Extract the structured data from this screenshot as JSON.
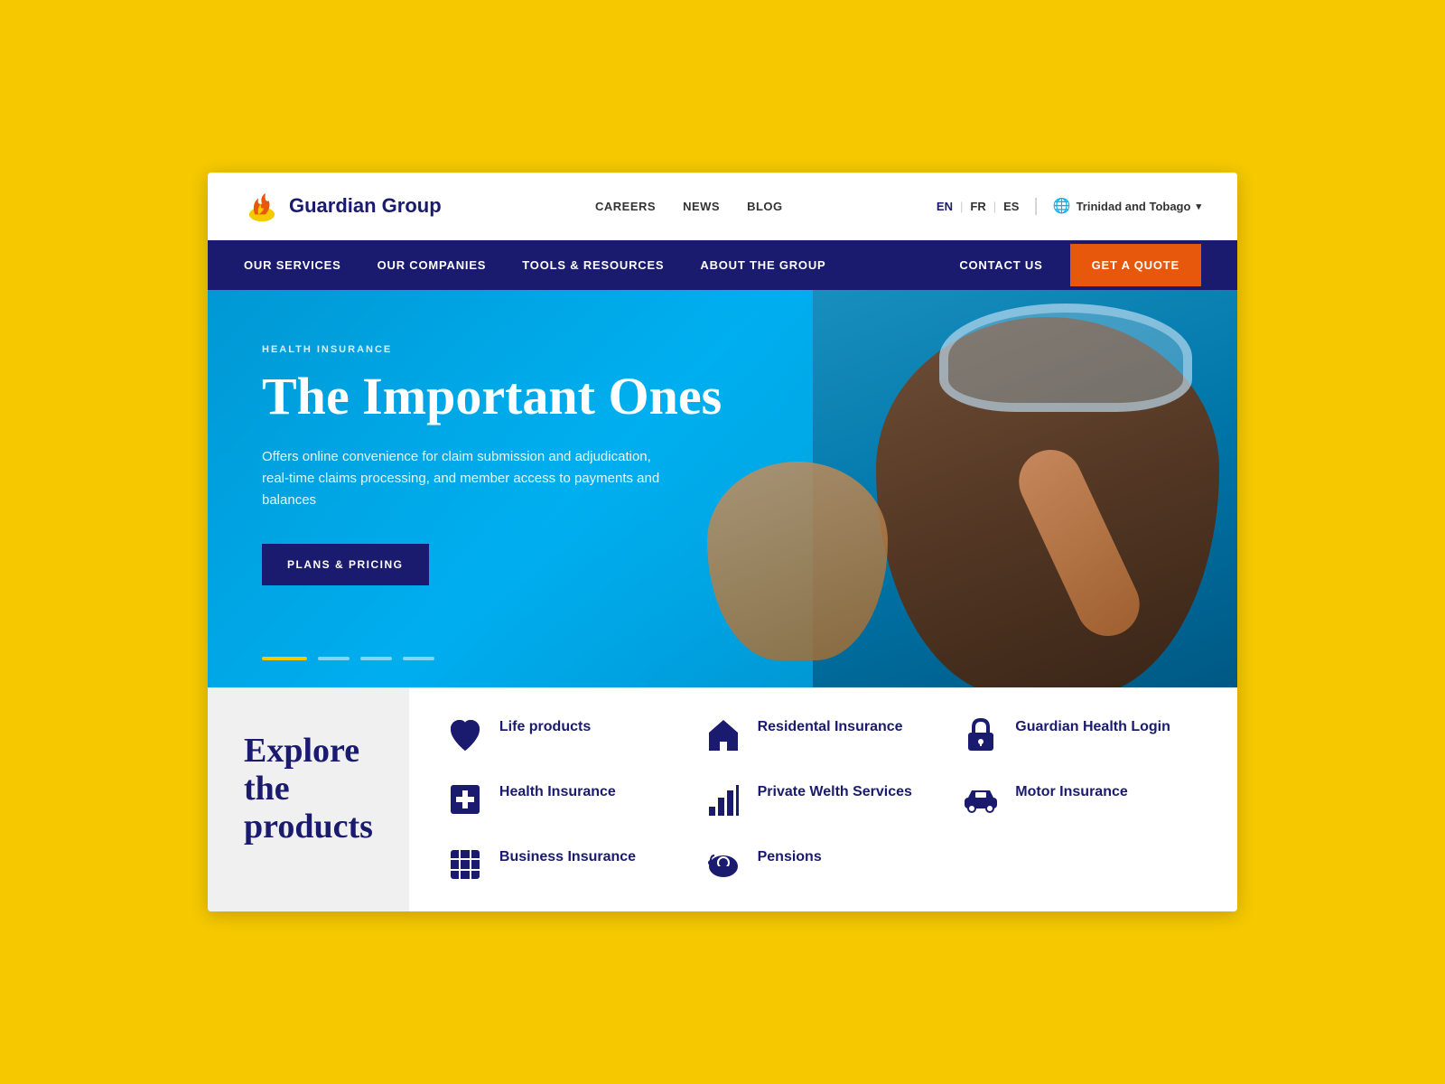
{
  "page": {
    "background_color": "#F5C800"
  },
  "top_bar": {
    "logo_text": "Guardian Group",
    "links": [
      {
        "label": "CAREERS",
        "id": "careers"
      },
      {
        "label": "NEWS",
        "id": "news"
      },
      {
        "label": "BLOG",
        "id": "blog"
      }
    ],
    "languages": [
      {
        "code": "EN",
        "active": true
      },
      {
        "code": "FR",
        "active": false
      },
      {
        "code": "ES",
        "active": false
      }
    ],
    "region": "Trinidad and Tobago"
  },
  "nav": {
    "items": [
      {
        "label": "OUR SERVICES",
        "id": "our-services"
      },
      {
        "label": "OUR COMPANIES",
        "id": "our-companies"
      },
      {
        "label": "TOOLS & RESOURCES",
        "id": "tools-resources"
      },
      {
        "label": "ABOUT THE GROUP",
        "id": "about-group"
      }
    ],
    "contact_label": "CONTACT US",
    "cta_label": "GET A QUOTE"
  },
  "hero": {
    "tag": "HEALTH INSURANCE",
    "title": "The Important Ones",
    "description": "Offers online convenience for claim submission and adjudication, real-time claims processing, and member access to payments and balances",
    "cta_label": "PLANS & PRICING",
    "dots": [
      {
        "active": true
      },
      {
        "active": false
      },
      {
        "active": false
      },
      {
        "active": false
      }
    ]
  },
  "products": {
    "explore_title": "Explore the products",
    "items": [
      {
        "id": "life-products",
        "label": "Life products",
        "icon": "shield"
      },
      {
        "id": "residential-insurance",
        "label": "Residental Insurance",
        "icon": "home"
      },
      {
        "id": "guardian-health-login",
        "label": "Guardian Health Login",
        "icon": "lock"
      },
      {
        "id": "health-insurance",
        "label": "Health Insurance",
        "icon": "health"
      },
      {
        "id": "private-wealth",
        "label": "Private Welth Services",
        "icon": "chart"
      },
      {
        "id": "motor-insurance",
        "label": "Motor Insurance",
        "icon": "car"
      },
      {
        "id": "business-insurance",
        "label": "Business Insurance",
        "icon": "grid"
      },
      {
        "id": "pensions",
        "label": "Pensions",
        "icon": "piggy"
      }
    ]
  }
}
